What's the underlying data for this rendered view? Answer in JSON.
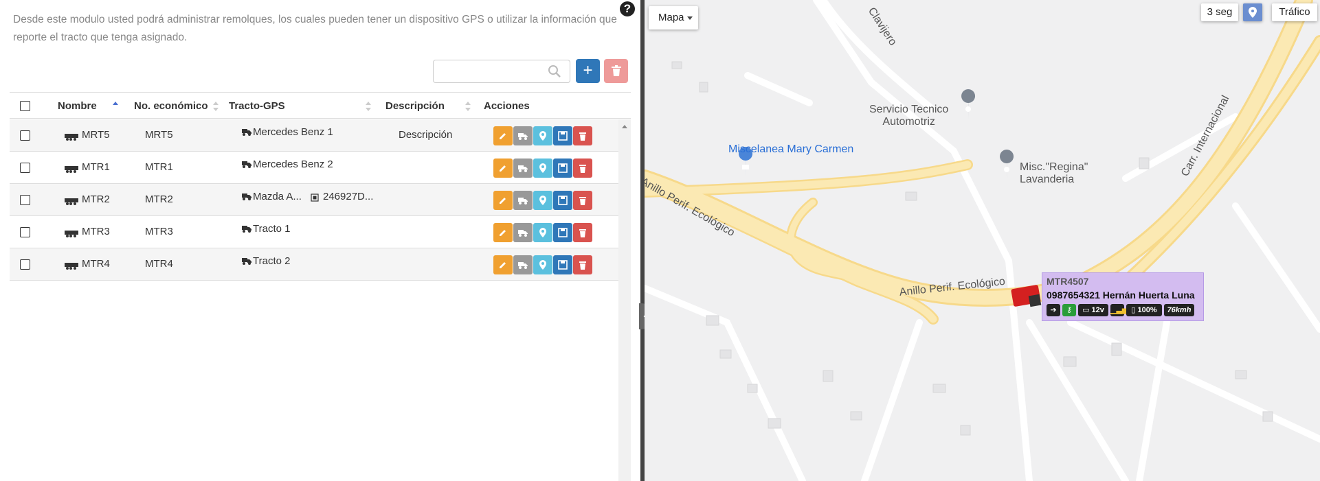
{
  "description": "Desde este modulo usted podrá administrar remolques, los cuales pueden tener un dispositivo GPS o utilizar la información que reporte el tracto que tenga asignado.",
  "help_label": "?",
  "search": {
    "value": "",
    "placeholder": ""
  },
  "toolbar": {
    "add_label": "+",
    "delete_label": "🗑"
  },
  "table": {
    "columns": [
      "Nombre",
      "No. económico",
      "Tracto-GPS",
      "Descripción",
      "Acciones"
    ],
    "rows": [
      {
        "name": "MRT5",
        "economic": "MRT5",
        "tractor": "Mercedes Benz 1",
        "gps": "",
        "description": "Descripción"
      },
      {
        "name": "MTR1",
        "economic": "MTR1",
        "tractor": "Mercedes Benz 2",
        "gps": "",
        "description": ""
      },
      {
        "name": "MTR2",
        "economic": "MTR2",
        "tractor": "Mazda A...",
        "gps": "246927D...",
        "description": ""
      },
      {
        "name": "MTR3",
        "economic": "MTR3",
        "tractor": "Tracto 1",
        "gps": "",
        "description": ""
      },
      {
        "name": "MTR4",
        "economic": "MTR4",
        "tractor": "Tracto 2",
        "gps": "",
        "description": ""
      }
    ]
  },
  "map": {
    "type_label": "Mapa",
    "refresh_label": "3 seg",
    "traffic_label": "Tráfico",
    "labels": {
      "clavijero": "Clavijero",
      "servicio": "Servicio Tecnico\nAutomotriz",
      "miscelanea": "Miscelanea Mary Carmen",
      "regina": "Misc.\"Regina\"\nLavanderia",
      "anillo1": "Anillo Perif. Ecológico",
      "anillo2": "Anillo Perif. Ecológico",
      "carr": "Carr. Internacional"
    },
    "vehicle": {
      "ids": "MTR4507",
      "driver": "0987654321 Hernán Huerta Luna",
      "voltage": "12v",
      "battery": "100%",
      "speed": "76kmh"
    }
  },
  "colors": {
    "primary": "#2f77b8",
    "warning": "#f0a030",
    "info": "#5bc0de",
    "danger": "#d9534f",
    "road": "#fbe29a"
  }
}
